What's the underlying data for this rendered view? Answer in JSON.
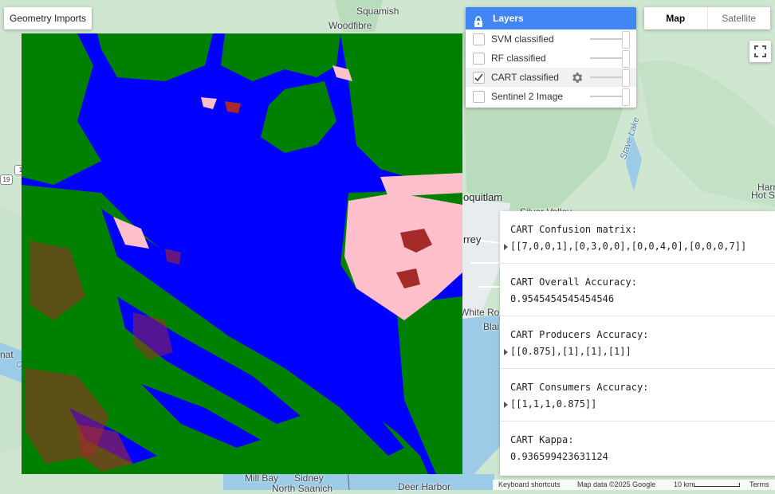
{
  "colors": {
    "water": "#0000ff",
    "forest": "#008000",
    "urban": "#ffc0cb",
    "bare": "#a52a2a",
    "layers_accent": "#4285f4",
    "basemap_land": "#cfe6d0",
    "basemap_water": "#9ccbe8"
  },
  "geometry_imports": {
    "label": "Geometry Imports"
  },
  "layers_panel": {
    "title": "Layers",
    "lock_icon": "lock-icon",
    "items": [
      {
        "label": "SVM classified",
        "checked": false,
        "opacity": 1
      },
      {
        "label": "RF classified",
        "checked": false,
        "opacity": 1
      },
      {
        "label": "CART classified",
        "checked": true,
        "opacity": 1,
        "settings_icon": "gear-icon"
      },
      {
        "label": "Sentinel 2 Image",
        "checked": false,
        "opacity": 1
      }
    ]
  },
  "map_type": {
    "map_label": "Map",
    "satellite_label": "Satellite",
    "selected": "Map"
  },
  "fullscreen_icon": "fullscreen-icon",
  "map_labels": {
    "squamish": "Squamish",
    "woodfibre": "Woodfibre",
    "coquitlam": "oquitlam",
    "silver_valley": "Silver Valley",
    "surrey": "rrey",
    "white_rock": "White Roc",
    "blaine": "Blai",
    "stave_lake": "Stave Lake",
    "harrison": "Harr",
    "hot_springs": "Hot S",
    "nat": "nat",
    "cow": "Co",
    "mill_bay": "Mill Bay",
    "sidney": "Sidney",
    "north_saanich": "North Saanich",
    "deer_harbor": "Deer Harbor",
    "route_19": "19",
    "route_1": "1"
  },
  "console": {
    "entries": [
      {
        "label": "CART Confusion matrix:",
        "value": "[[7,0,0,1],[0,3,0,0],[0,0,4,0],[0,0,0,7]]",
        "expandable": true
      },
      {
        "label": "CART Overall Accuracy:",
        "value": "0.9545454545454546",
        "expandable": false
      },
      {
        "label": "CART Producers Accuracy:",
        "value": "[[0.875],[1],[1],[1]]",
        "expandable": true
      },
      {
        "label": "CART Consumers Accuracy:",
        "value": "[[1,1,1,0.875]]",
        "expandable": true
      },
      {
        "label": "CART Kappa:",
        "value": "0.936599423631124",
        "expandable": false
      }
    ]
  },
  "attribution": {
    "keyboard_shortcuts": "Keyboard shortcuts",
    "map_data": "Map data ©2025 Google",
    "scale": "10 km",
    "terms": "Terms"
  }
}
